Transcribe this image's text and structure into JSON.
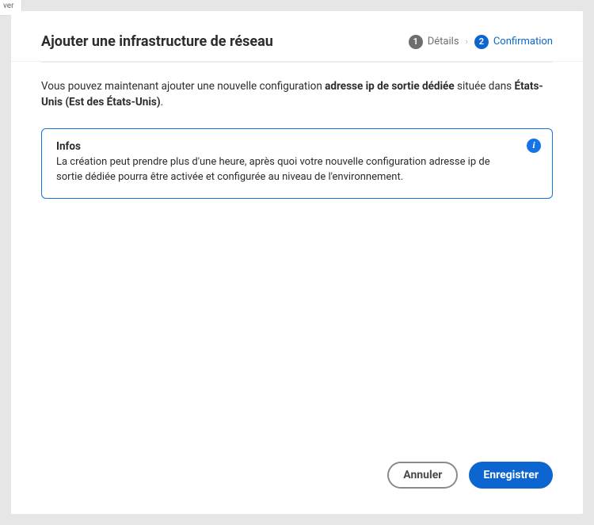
{
  "bg": {
    "fragment": "ver"
  },
  "modal": {
    "title": "Ajouter une infrastructure de réseau",
    "stepper": {
      "step1": {
        "num": "1",
        "label": "Détails"
      },
      "sep": "›",
      "step2": {
        "num": "2",
        "label": "Confirmation"
      }
    },
    "summary": {
      "pre": "Vous pouvez maintenant ajouter une nouvelle configuration ",
      "type": "adresse ip de sortie dédiée",
      "mid": " située dans ",
      "region": "États-Unis (Est des États-Unis)",
      "post": "."
    },
    "info": {
      "title": "Infos",
      "text": "La création peut prendre plus d'une heure, après quoi votre nouvelle configuration adresse ip de sortie dédiée pourra être activée et configurée au niveau de l'environnement.",
      "icon": "i"
    },
    "footer": {
      "cancel": "Annuler",
      "save": "Enregistrer"
    }
  }
}
